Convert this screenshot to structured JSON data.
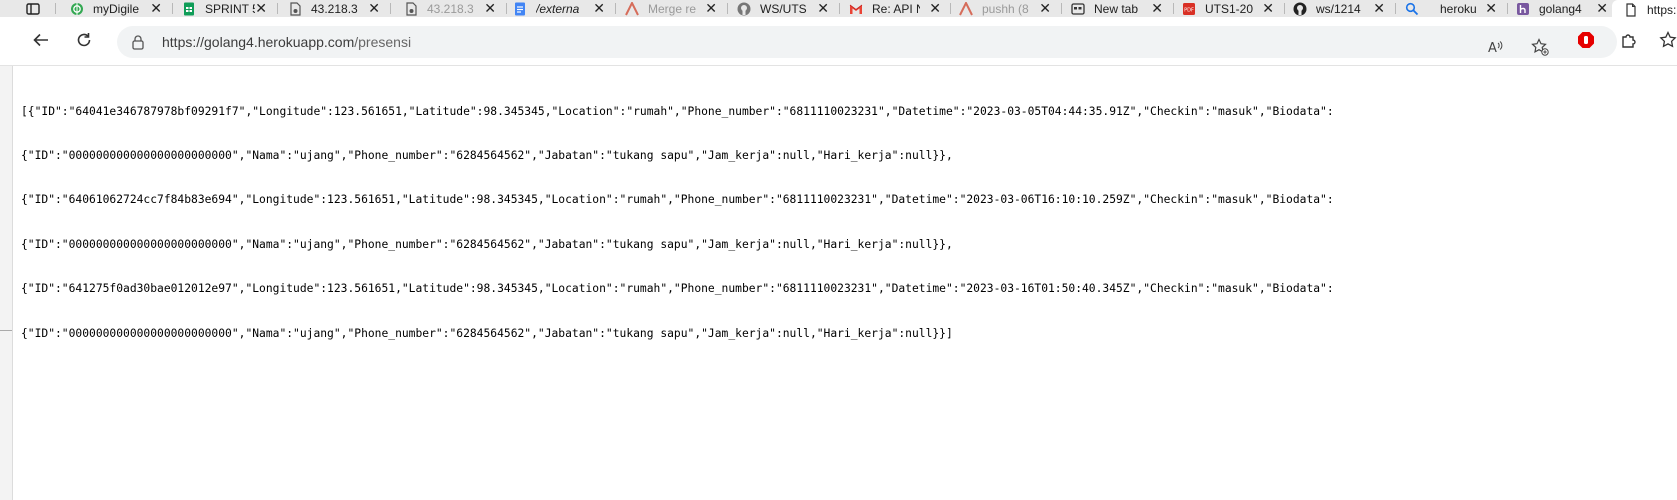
{
  "tabs": [
    {
      "title": "",
      "icon": "sidebar-toggle-icon",
      "faded": false,
      "closable": false
    },
    {
      "title": "myDigile",
      "icon": "globe-green-icon",
      "faded": false,
      "closable": true
    },
    {
      "title": "SPRINT 5",
      "icon": "sheets-icon",
      "faded": false,
      "closable": true
    },
    {
      "title": "43.218.3",
      "icon": "page-gear-icon",
      "faded": false,
      "closable": true
    },
    {
      "title": "43.218.3",
      "icon": "page-gear-icon",
      "faded": true,
      "closable": true
    },
    {
      "title": "/externa",
      "icon": "docs-icon",
      "faded": false,
      "closable": true
    },
    {
      "title": "Merge re",
      "icon": "merge-icon",
      "faded": true,
      "closable": true
    },
    {
      "title": "WS/UTS",
      "icon": "github-icon",
      "faded": false,
      "closable": true
    },
    {
      "title": "Re: API N",
      "icon": "gmail-icon",
      "faded": false,
      "closable": true
    },
    {
      "title": "pushh (8",
      "icon": "merge-icon",
      "faded": true,
      "closable": true
    },
    {
      "title": "New tab",
      "icon": "newtab-icon",
      "faded": false,
      "closable": true
    },
    {
      "title": "UTS1-20",
      "icon": "pdf-icon",
      "faded": false,
      "closable": true
    },
    {
      "title": "ws/1214",
      "icon": "github-icon",
      "faded": false,
      "closable": true
    },
    {
      "title": "heroku",
      "icon": "search-icon",
      "faded": false,
      "closable": true
    },
    {
      "title": "golang4",
      "icon": "heroku-icon",
      "faded": false,
      "closable": true
    },
    {
      "title": "https:",
      "icon": "page-icon",
      "faded": false,
      "closable": false,
      "active": true
    }
  ],
  "address_bar": {
    "url_host": "https://golang4.herokuapp.com",
    "url_path": "/presensi"
  },
  "content_lines": [
    "[{\"ID\":\"64041e346787978bf09291f7\",\"Longitude\":123.561651,\"Latitude\":98.345345,\"Location\":\"rumah\",\"Phone_number\":\"6811110023231\",\"Datetime\":\"2023-03-05T04:44:35.91Z\",\"Checkin\":\"masuk\",\"Biodata\":",
    "{\"ID\":\"000000000000000000000000\",\"Nama\":\"ujang\",\"Phone_number\":\"6284564562\",\"Jabatan\":\"tukang sapu\",\"Jam_kerja\":null,\"Hari_kerja\":null}},",
    "{\"ID\":\"64061062724cc7f84b83e694\",\"Longitude\":123.561651,\"Latitude\":98.345345,\"Location\":\"rumah\",\"Phone_number\":\"6811110023231\",\"Datetime\":\"2023-03-06T16:10:10.259Z\",\"Checkin\":\"masuk\",\"Biodata\":",
    "{\"ID\":\"000000000000000000000000\",\"Nama\":\"ujang\",\"Phone_number\":\"6284564562\",\"Jabatan\":\"tukang sapu\",\"Jam_kerja\":null,\"Hari_kerja\":null}},",
    "{\"ID\":\"641275f0ad30bae012012e97\",\"Longitude\":123.561651,\"Latitude\":98.345345,\"Location\":\"rumah\",\"Phone_number\":\"6811110023231\",\"Datetime\":\"2023-03-16T01:50:40.345Z\",\"Checkin\":\"masuk\",\"Biodata\":",
    "{\"ID\":\"000000000000000000000000\",\"Nama\":\"ujang\",\"Phone_number\":\"6284564562\",\"Jabatan\":\"tukang sapu\",\"Jam_kerja\":null,\"Hari_kerja\":null}}]"
  ],
  "colors": {
    "tabbar_bg": "#e8e8e8",
    "omnibox_bg": "#f1f3f4",
    "sheets_green": "#0f9d58",
    "docs_blue": "#4285f4",
    "heroku_purple": "#79589f",
    "adblock_red": "#e60000"
  }
}
